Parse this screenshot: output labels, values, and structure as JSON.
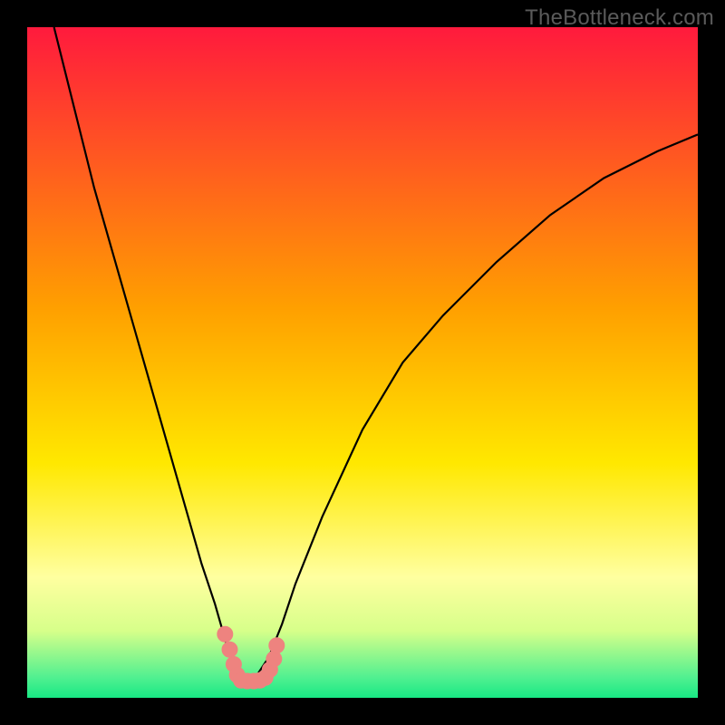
{
  "watermark": "TheBottleneck.com",
  "chart_data": {
    "type": "line",
    "title": "",
    "xlabel": "",
    "ylabel": "",
    "xlim": [
      0,
      100
    ],
    "ylim": [
      0,
      100
    ],
    "grid": false,
    "background": "rainbow-gradient-vertical",
    "gradient_stops": [
      {
        "offset": 0.0,
        "color": "#ff1a3d"
      },
      {
        "offset": 0.42,
        "color": "#ffa000"
      },
      {
        "offset": 0.65,
        "color": "#ffe800"
      },
      {
        "offset": 0.82,
        "color": "#ffffa0"
      },
      {
        "offset": 0.9,
        "color": "#d7ff8a"
      },
      {
        "offset": 0.97,
        "color": "#50f090"
      },
      {
        "offset": 1.0,
        "color": "#18e884"
      }
    ],
    "series": [
      {
        "name": "bottleneck-curve",
        "x": [
          4,
          6,
          8,
          10,
          12,
          14,
          16,
          18,
          20,
          22,
          24,
          26,
          28,
          30,
          31,
          32,
          33,
          34,
          36,
          38,
          40,
          44,
          50,
          56,
          62,
          70,
          78,
          86,
          94,
          100
        ],
        "y": [
          100,
          92,
          84,
          76,
          69,
          62,
          55,
          48,
          41,
          34,
          27,
          20,
          14,
          7,
          4,
          2.5,
          2.5,
          3,
          6,
          11,
          17,
          27,
          40,
          50,
          57,
          65,
          72,
          77.5,
          81.5,
          84
        ]
      },
      {
        "name": "optimal-region-markers",
        "type": "scatter",
        "color": "#ee837f",
        "x": [
          29.5,
          30.2,
          30.8,
          31.3,
          31.9,
          32.8,
          33.8,
          34.7,
          35.5,
          36.2,
          36.8,
          37.2
        ],
        "y": [
          9.5,
          7.2,
          5.0,
          3.4,
          2.6,
          2.5,
          2.5,
          2.6,
          3.0,
          4.2,
          5.8,
          7.8
        ]
      }
    ]
  }
}
